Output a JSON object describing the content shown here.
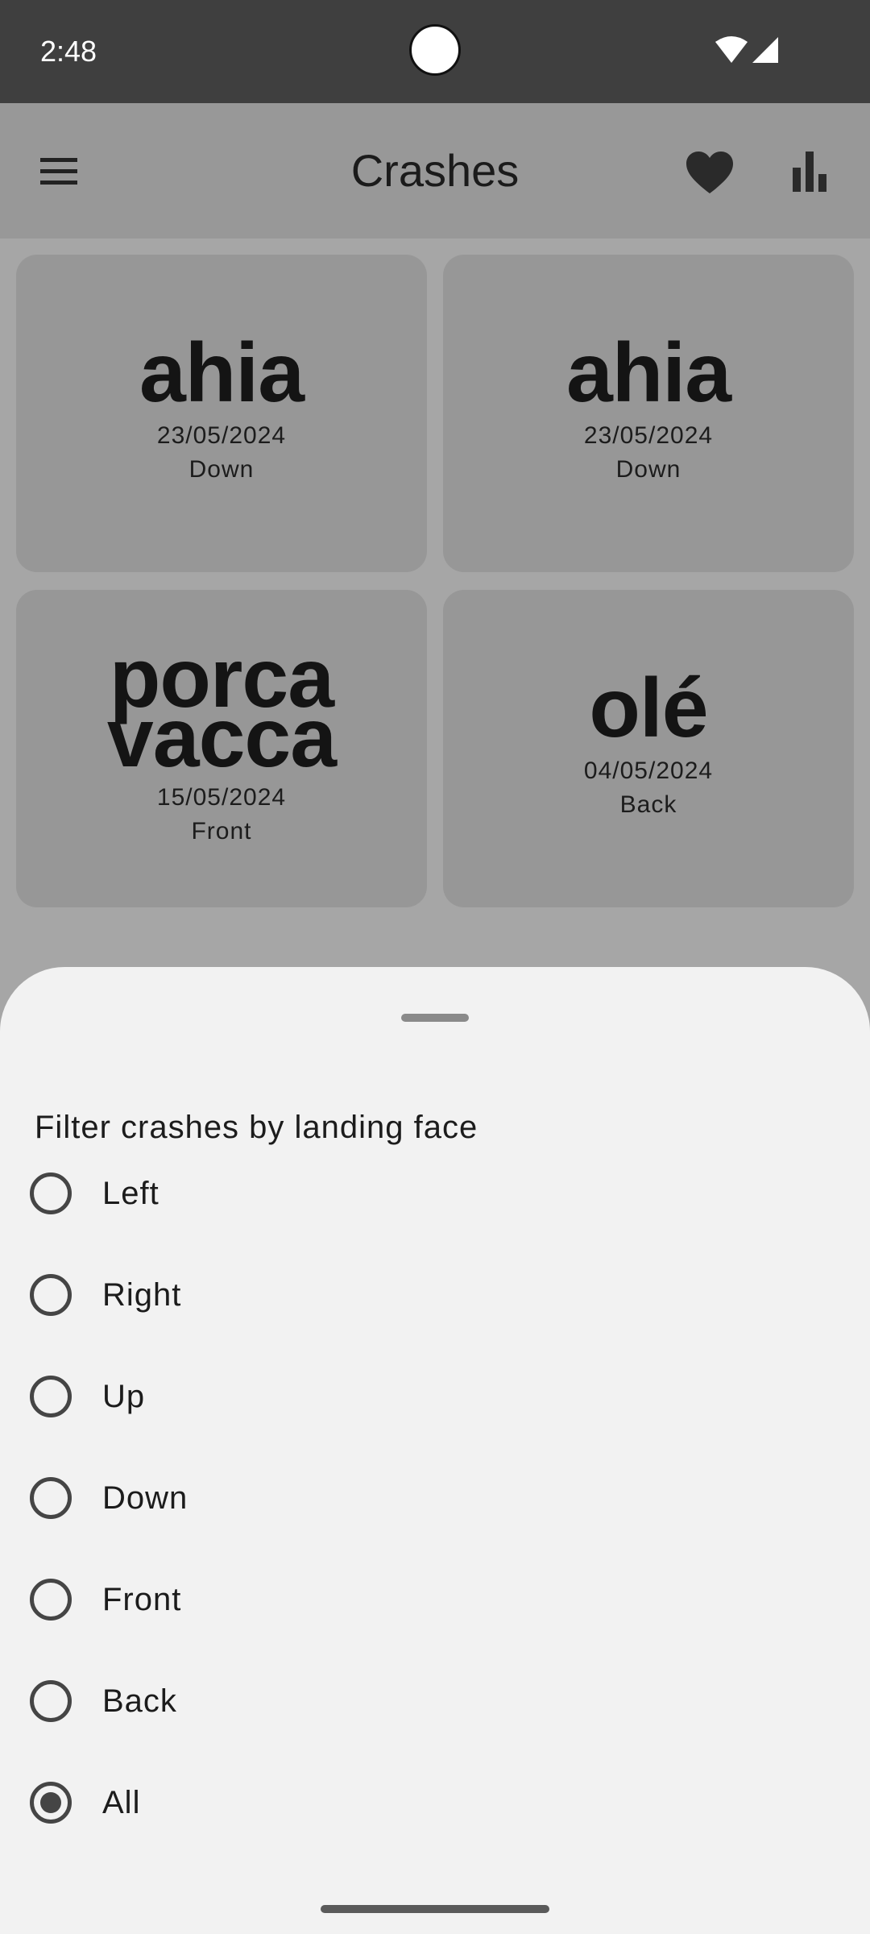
{
  "status_bar": {
    "time": "2:48",
    "icons": [
      "wifi-icon",
      "cell-signal-icon"
    ]
  },
  "app_bar": {
    "title": "Crashes",
    "icons": [
      "menu-icon",
      "heart-icon",
      "stats-icon"
    ]
  },
  "crashes": [
    {
      "title": "ahia",
      "date": "23/05/2024",
      "face": "Down"
    },
    {
      "title": "ahia",
      "date": "23/05/2024",
      "face": "Down"
    },
    {
      "title_line1": "porca",
      "title_line2": "vacca",
      "date": "15/05/2024",
      "face": "Front"
    },
    {
      "title": "olé",
      "date": "04/05/2024",
      "face": "Back"
    }
  ],
  "filter_sheet": {
    "title": "Filter crashes by landing face",
    "options": [
      {
        "label": "Left",
        "selected": false
      },
      {
        "label": "Right",
        "selected": false
      },
      {
        "label": "Up",
        "selected": false
      },
      {
        "label": "Down",
        "selected": false
      },
      {
        "label": "Front",
        "selected": false
      },
      {
        "label": "Back",
        "selected": false
      },
      {
        "label": "All",
        "selected": true
      }
    ]
  },
  "colors": {
    "status_bar": "#3f3f3f",
    "app_bar": "#989898",
    "scrim": "#a6a6a6",
    "card": "#979797",
    "sheet": "#f2f2f2",
    "radio": "#454545"
  }
}
